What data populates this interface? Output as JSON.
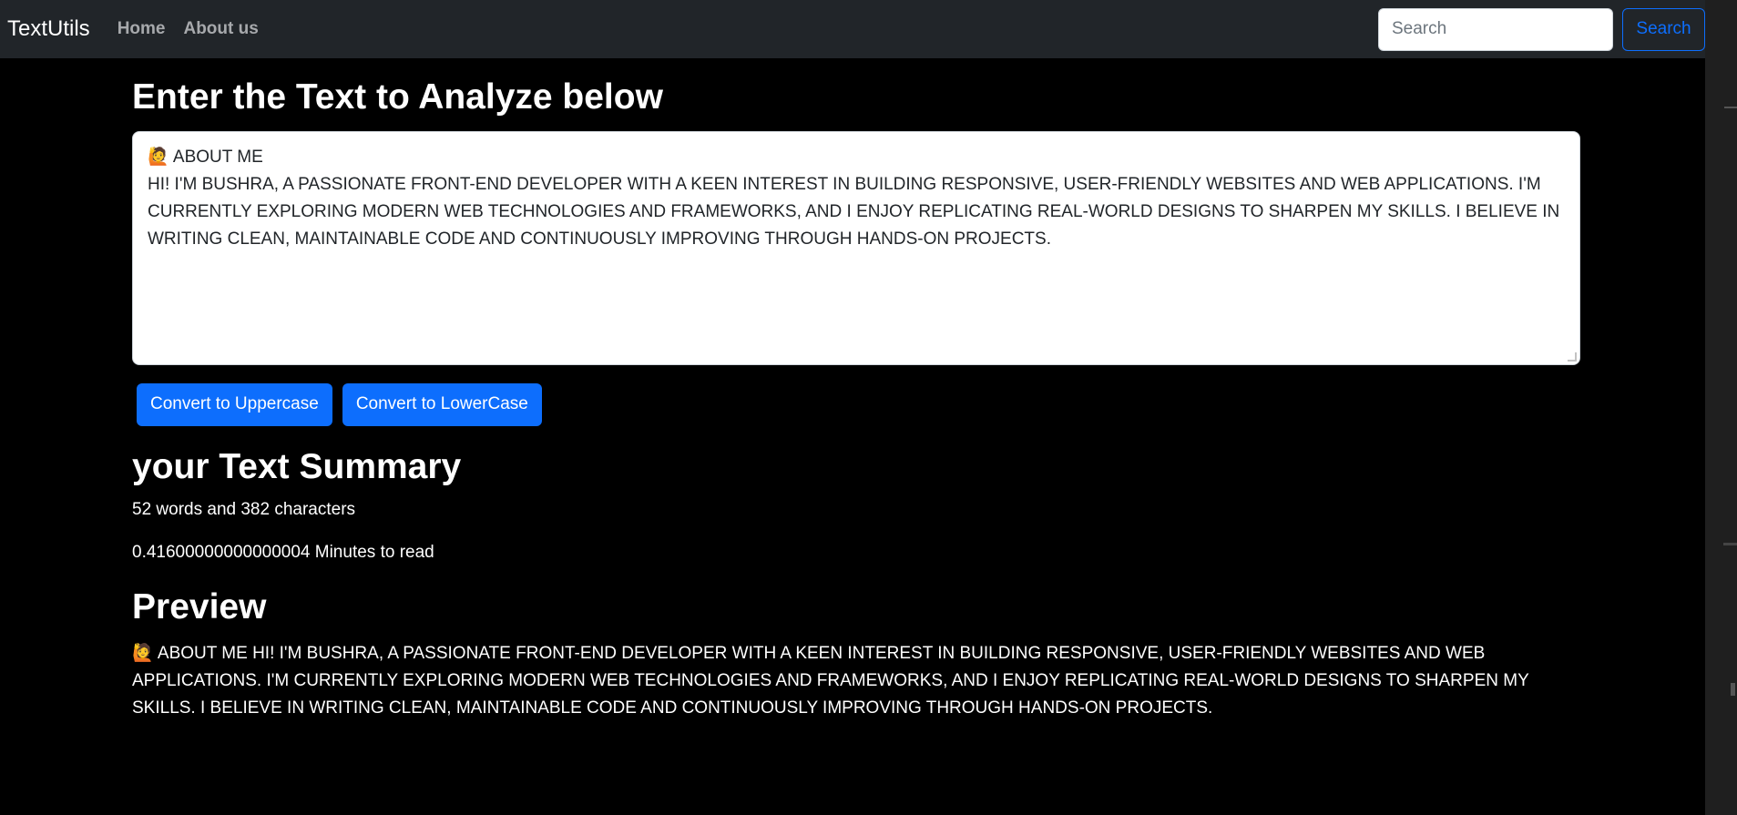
{
  "navbar": {
    "brand": "TextUtils",
    "links": [
      "Home",
      "About us"
    ],
    "search_placeholder": "Search",
    "search_button": "Search"
  },
  "main": {
    "heading": "Enter the Text to Analyze below",
    "textarea_emoji": "🙋",
    "textarea_line1": "ABOUT ME",
    "textarea_body": "HI! I'M BUSHRA, A PASSIONATE FRONT-END DEVELOPER WITH A KEEN INTEREST IN BUILDING RESPONSIVE, USER-FRIENDLY WEBSITES AND WEB APPLICATIONS. I'M CURRENTLY EXPLORING MODERN WEB TECHNOLOGIES AND FRAMEWORKS, AND I ENJOY REPLICATING REAL-WORLD DESIGNS TO SHARPEN MY SKILLS. I BELIEVE IN WRITING CLEAN, MAINTAINABLE CODE AND CONTINUOUSLY IMPROVING THROUGH HANDS-ON PROJECTS.",
    "buttons": [
      "Convert to Uppercase",
      "Convert to LowerCase"
    ]
  },
  "summary": {
    "heading": "your Text Summary",
    "count_line": "52 words and 382 characters",
    "read_time_line": "0.41600000000000004 Minutes to read"
  },
  "preview": {
    "heading": "Preview",
    "emoji": "🙋",
    "text": "ABOUT ME HI! I'M BUSHRA, A PASSIONATE FRONT-END DEVELOPER WITH A KEEN INTEREST IN BUILDING RESPONSIVE, USER-FRIENDLY WEBSITES AND WEB APPLICATIONS. I'M CURRENTLY EXPLORING MODERN WEB TECHNOLOGIES AND FRAMEWORKS, AND I ENJOY REPLICATING REAL-WORLD DESIGNS TO SHARPEN MY SKILLS. I BELIEVE IN WRITING CLEAN, MAINTAINABLE CODE AND CONTINUOUSLY IMPROVING THROUGH HANDS-ON PROJECTS."
  },
  "colors": {
    "navbar_bg": "#212529",
    "page_bg": "#000000",
    "primary": "#0d6efd"
  }
}
